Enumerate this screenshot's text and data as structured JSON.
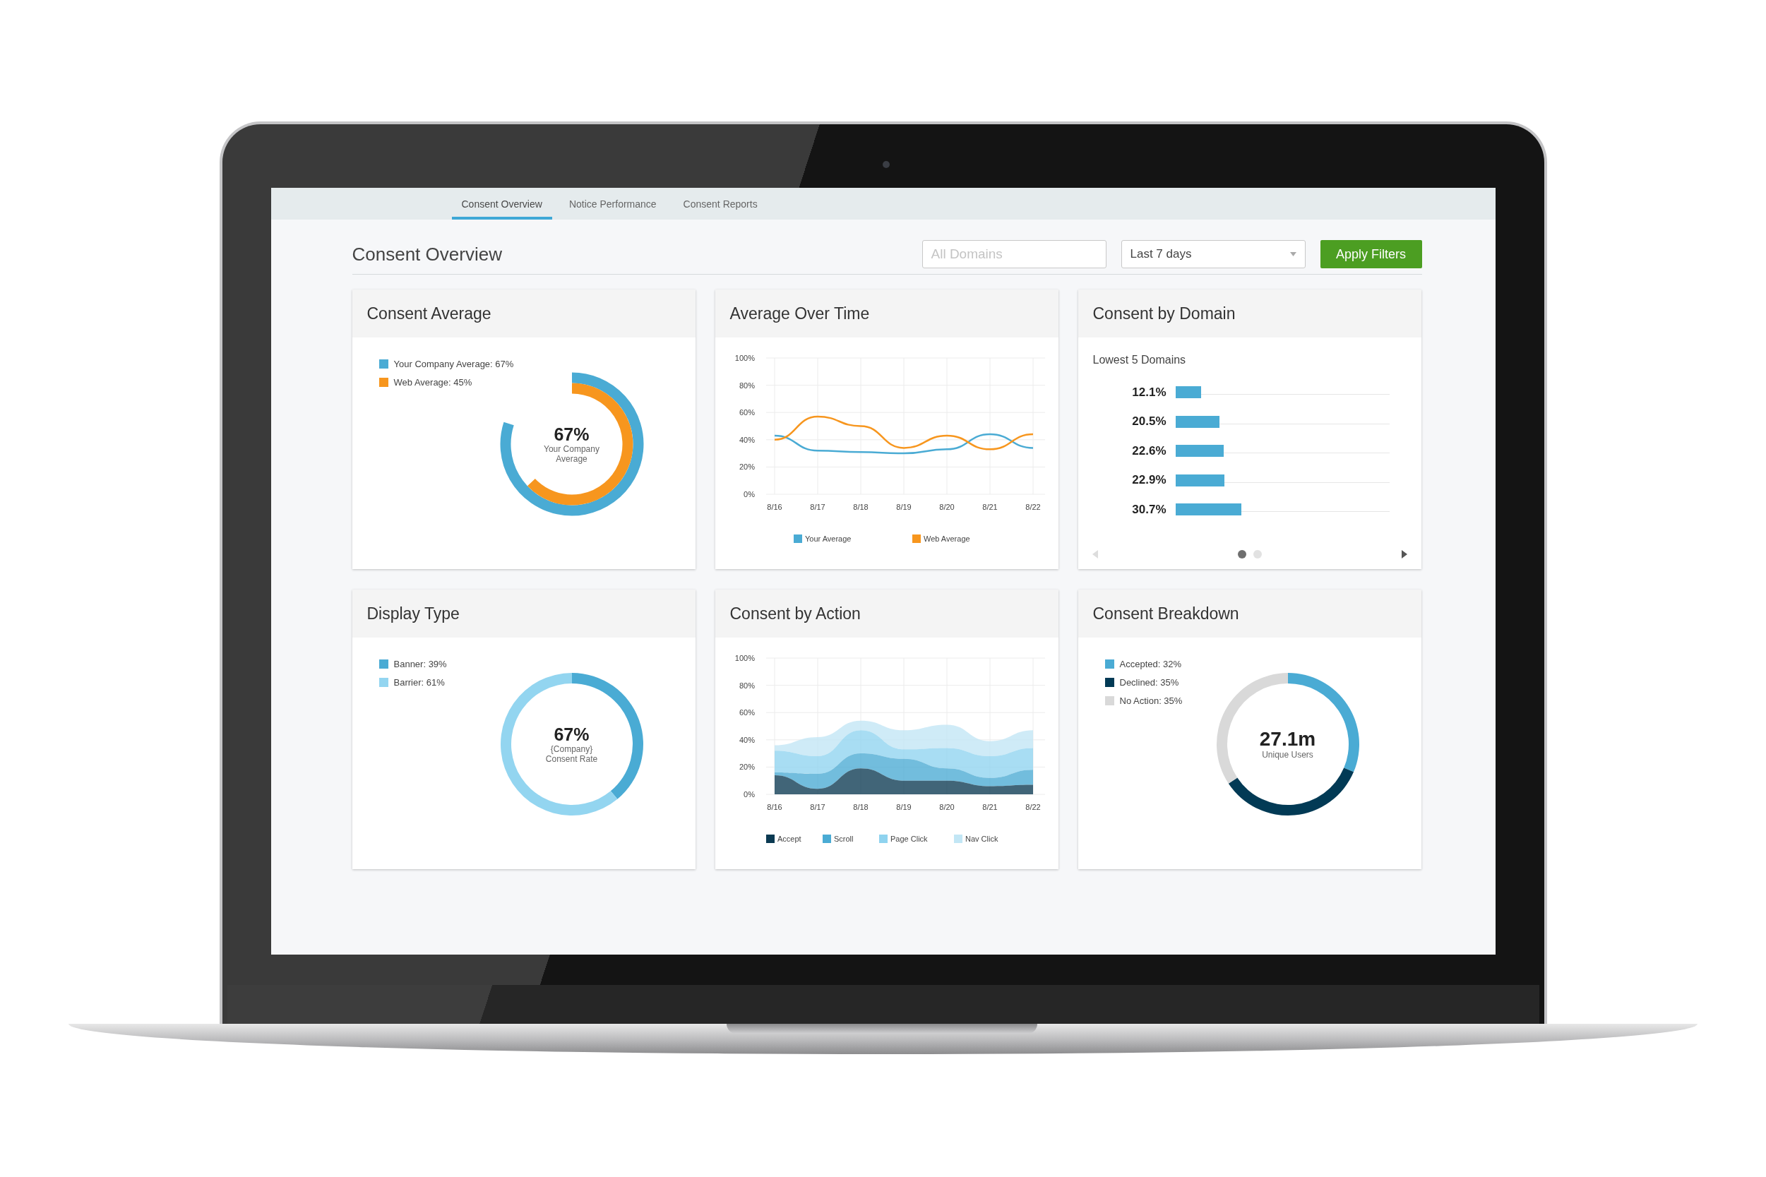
{
  "tabs": [
    {
      "label": "Consent Overview",
      "selected": true
    },
    {
      "label": "Notice Performance",
      "selected": false
    },
    {
      "label": "Consent Reports",
      "selected": false
    }
  ],
  "header": {
    "title": "Consent Overview",
    "domain_field": {
      "placeholder": "All Domains"
    },
    "range_select": {
      "value": "Last 7 days"
    },
    "apply_button": "Apply Filters"
  },
  "cards": [
    {
      "kind": "rings",
      "title": "Consent Average",
      "rings": [
        {
          "label": "Your Company Average: 67%",
          "color": "#4aabd4"
        },
        {
          "label": "Web Average: 45%",
          "color": "#f7961e"
        }
      ],
      "center_value": "67%",
      "center_caption": "Your Company Average"
    },
    {
      "kind": "chart",
      "title": "Average Over Time",
      "chart_data": {
        "type": "line",
        "grid": true,
        "legend": "bottom",
        "categories": [
          "8/16",
          "8/17",
          "8/18",
          "8/19",
          "8/20",
          "8/21",
          "8/22"
        ],
        "ylim": [
          0,
          100
        ],
        "yticks": [
          {
            "value": 0,
            "label": "0%"
          },
          {
            "value": 20,
            "label": "20%"
          },
          {
            "value": 40,
            "label": "40%"
          },
          {
            "value": 60,
            "label": "60%"
          },
          {
            "value": 80,
            "label": "80%"
          },
          {
            "value": 100,
            "label": "100%"
          }
        ],
        "series": [
          {
            "name": "Your Average",
            "color": "#4aabd4",
            "values": [
              43,
              32,
              31,
              30,
              33,
              44,
              34
            ]
          },
          {
            "name": "Web Average",
            "color": "#f7961e",
            "values": [
              40,
              57,
              50,
              34,
              43,
              33,
              44
            ]
          }
        ]
      }
    },
    {
      "kind": "bars",
      "title": "Consent by Domain",
      "domains": {
        "title": "Lowest 5 Domains",
        "rows": [
          {
            "reading": "12.1%",
            "level": 0.121
          },
          {
            "reading": "20.5%",
            "level": 0.205
          },
          {
            "reading": "22.6%",
            "level": 0.226
          },
          {
            "reading": "22.9%",
            "level": 0.229
          },
          {
            "reading": "30.7%",
            "level": 0.307
          }
        ]
      },
      "pager": {
        "prev": {
          "disabled": true
        },
        "next": {
          "disabled": false
        },
        "pages": [
          {
            "selected": true
          },
          {
            "selected": false
          }
        ]
      }
    },
    {
      "kind": "donut",
      "title": "Display Type",
      "legend": [
        {
          "color": "#4aabd4"
        },
        {
          "color": "#93d5f0"
        }
      ],
      "chart_data": {
        "type": "donut",
        "categories": [
          "Banner: 39%",
          "Barrier: 61%"
        ],
        "values": [
          39,
          61
        ]
      },
      "center_value": "67%",
      "center_caption": "{Company} Consent Rate"
    },
    {
      "kind": "chart",
      "title": "Consent by Action",
      "chart_data": {
        "type": "area",
        "grid": true,
        "legend": "bottom",
        "stacked": true,
        "categories": [
          "8/16",
          "8/17",
          "8/18",
          "8/19",
          "8/20",
          "8/21",
          "8/22"
        ],
        "ylim": [
          0,
          100
        ],
        "yticks": [
          {
            "value": 0,
            "label": "0%"
          },
          {
            "value": 20,
            "label": "20%"
          },
          {
            "value": 40,
            "label": "40%"
          },
          {
            "value": 60,
            "label": "60%"
          },
          {
            "value": 80,
            "label": "80%"
          },
          {
            "value": 100,
            "label": "100%"
          }
        ],
        "series": [
          {
            "name": "Accept",
            "color": "#0b3a52",
            "values": [
              14,
              4,
              19,
              10,
              10,
              6,
              7
            ]
          },
          {
            "name": "Scroll",
            "color": "#4aabd4",
            "values": [
              2,
              11,
              11,
              16,
              9,
              6,
              11
            ]
          },
          {
            "name": "Page Click",
            "color": "#8fd3ef",
            "values": [
              16,
              13,
              17,
              7,
              15,
              16,
              16
            ]
          },
          {
            "name": "Nav Click",
            "color": "#c2e6f5",
            "values": [
              4,
              14,
              7,
              14,
              17,
              11,
              13
            ]
          }
        ]
      }
    },
    {
      "kind": "donut",
      "title": "Consent Breakdown",
      "legend": [
        {
          "color": "#4aabd4"
        },
        {
          "color": "#023a55"
        },
        {
          "color": "#d9d9d9"
        }
      ],
      "chart_data": {
        "type": "donut",
        "categories": [
          "Accepted: 32%",
          "Declined: 35%",
          "No Action: 35%"
        ],
        "values": [
          32,
          35,
          35
        ]
      },
      "center_value": "27.1m",
      "center_caption": "Unique Users"
    }
  ]
}
